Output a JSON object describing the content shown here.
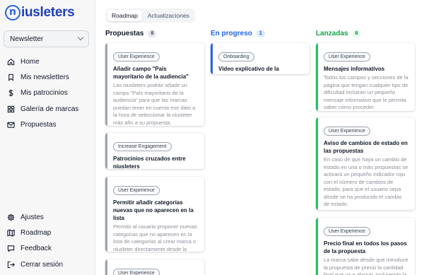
{
  "app": {
    "logo_mark": "n",
    "logo_text": "iusleters"
  },
  "newsletter_select": {
    "value": "Newsletter"
  },
  "sidebar": {
    "top_items": [
      {
        "label": "Home",
        "icon": "home-icon"
      },
      {
        "label": "Mis newsletters",
        "icon": "bookmark-icon"
      },
      {
        "label": "Mis patrocinios",
        "icon": "dollar-icon"
      },
      {
        "label": "Galería de marcas",
        "icon": "grid-icon"
      },
      {
        "label": "Propuestas",
        "icon": "mail-icon"
      }
    ],
    "bottom_items": [
      {
        "label": "Ajustes",
        "icon": "gear-icon"
      },
      {
        "label": "Roadmap",
        "icon": "map-icon"
      },
      {
        "label": "Feedback",
        "icon": "chat-icon"
      },
      {
        "label": "Cerrar sesión",
        "icon": "logout-icon"
      }
    ]
  },
  "tabs": [
    {
      "label": "Roadmap",
      "active": true
    },
    {
      "label": "Actualizaciones",
      "active": false
    }
  ],
  "columns": [
    {
      "title": "Propuestas",
      "count": "8",
      "accent": "#111827",
      "badge_bg": "#e5e7eb",
      "badge_fg": "#374151",
      "bar": "#9ca3af",
      "cards": [
        {
          "tag": "User Experience",
          "title": "Añadir campo \"País mayoritario de la audiencia\"",
          "desc": "Las niusleters podrán añadir un campo \"País mayoritario de la audiencia\" para que las marcas puedan tener en cuenta ese dato a la hora de seleccionar la niusleter más afín a su propuesta."
        },
        {
          "tag": "Increase Engagement",
          "title": "Patrocinios cruzados entre niusleters",
          "desc": ""
        },
        {
          "tag": "User Experience",
          "title": "Permitir añadir categorías nuevas que no aparecen en la lista",
          "desc": "Permitir al usuario proponer nuevas categorías que no aparecen en la lista de categorías al crear marca o niusleter directamente desde la aplicación."
        },
        {
          "tag": "User Experience",
          "title": "",
          "desc": ""
        }
      ]
    },
    {
      "title": "En progreso",
      "count": "1",
      "accent": "#2563eb",
      "badge_bg": "#dbeafe",
      "badge_fg": "#1d4ed8",
      "bar": "#2563eb",
      "cards": [
        {
          "tag": "Onboarding",
          "title": "Vídeo explicativo de la plataforma",
          "desc": ""
        }
      ]
    },
    {
      "title": "Lanzadas",
      "count": "6",
      "accent": "#16a34a",
      "badge_bg": "#dcfce7",
      "badge_fg": "#15803d",
      "bar": "#22c55e",
      "cards": [
        {
          "tag": "User Experience",
          "title": "Mensajes informativos",
          "desc": "Todos los campos y secciones de la página que tengan cualquier tipo de dificultad incluirán un pequeño mensaje informativo que le permita saber cómo proceder."
        },
        {
          "tag": "User Experience",
          "title": "Aviso de cambios de estado en las propuestas",
          "desc": "En caso de que haya un cambio de estado en una o más propuestas se activará un pequeño indicador rojo con el número de cambios de estado, para que el usuario sepa dónde se ha producido el cambio de estado."
        },
        {
          "tag": "User Experience",
          "title": "Precio final en todos los pasos de la propuesta",
          "desc": "La marca sabe desde que introduce la propuesta de precio la cantidad final que va a abonar, incluyendo la comisión de la plataforma y los"
        }
      ]
    }
  ]
}
